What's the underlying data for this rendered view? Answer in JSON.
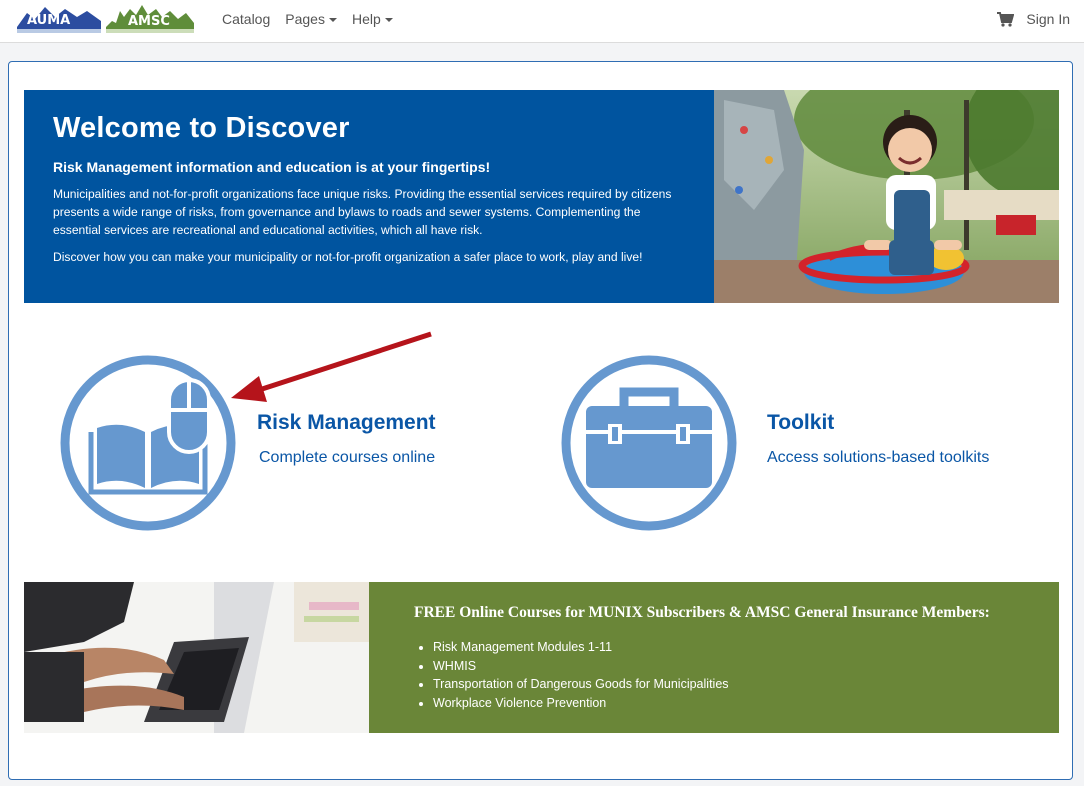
{
  "nav": {
    "logo_auma": "AUMA",
    "logo_amsc": "AMSC",
    "links": [
      {
        "label": "Catalog",
        "dropdown": false
      },
      {
        "label": "Pages",
        "dropdown": true
      },
      {
        "label": "Help",
        "dropdown": true
      }
    ],
    "cart_icon": "shopping-cart-icon",
    "sign_in": "Sign In"
  },
  "welcome": {
    "title": "Welcome to Discover",
    "subtitle": "Risk Management information and education is at your fingertips!",
    "paragraph1": "Municipalities and not-for-profit organizations face unique risks. Providing the essential services required by citizens presents a wide range of risks, from governance and bylaws to roads and sewer systems. Complementing the essential services are recreational and educational activities, which all have risk.",
    "paragraph2": "Discover how you can make your municipality or not-for-profit organization a safer place to work, play and live!"
  },
  "tiles": [
    {
      "title": "Risk Management",
      "subtitle": "Complete courses online",
      "icon": "book-mouse-icon"
    },
    {
      "title": "Toolkit",
      "subtitle": "Access solutions-based toolkits",
      "icon": "toolbox-icon"
    }
  ],
  "free_courses": {
    "title": "FREE Online Courses for MUNIX Subscribers & AMSC General Insurance Members:",
    "items": [
      "Risk Management Modules 1-11",
      "WHMIS",
      "Transportation of Dangerous Goods for Municipalities",
      "Workplace Violence Prevention"
    ]
  },
  "colors": {
    "brand_blue": "#00549f",
    "link_blue": "#0a56a6",
    "icon_blue": "#6698cf",
    "green": "#6a8638",
    "arrow_red": "#b5141b"
  }
}
